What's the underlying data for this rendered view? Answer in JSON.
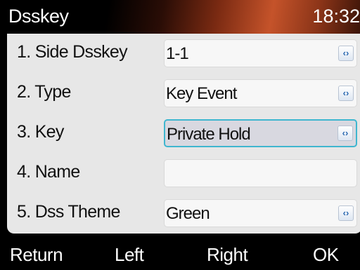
{
  "header": {
    "title": "Dsskey",
    "time": "18:32"
  },
  "rows": [
    {
      "label": "1. Side Dsskey",
      "value": "1-1",
      "has_arrow": true,
      "arrow_icon": "left-right-arrows-icon"
    },
    {
      "label": "2. Type",
      "value": "Key Event",
      "has_arrow": true,
      "arrow_icon": "left-right-arrows-icon"
    },
    {
      "label": "3. Key",
      "value": "Private Hold",
      "has_arrow": true,
      "selected": true,
      "arrow_icon": "left-right-arrows-icon"
    },
    {
      "label": "4. Name",
      "value": "",
      "has_arrow": false
    },
    {
      "label": "5. Dss Theme",
      "value": "Green",
      "has_arrow": true,
      "arrow_icon": "left-right-arrows-icon"
    }
  ],
  "arrow_glyph": "‹›",
  "softkeys": {
    "return": "Return",
    "left": "Left",
    "right": "Right",
    "ok": "OK"
  },
  "colors": {
    "panel_background": "#e7e7e7",
    "selected_border": "#3fb6cf",
    "arrow_color": "#2c6ab2",
    "title_bar_accent": "#c5532a"
  }
}
